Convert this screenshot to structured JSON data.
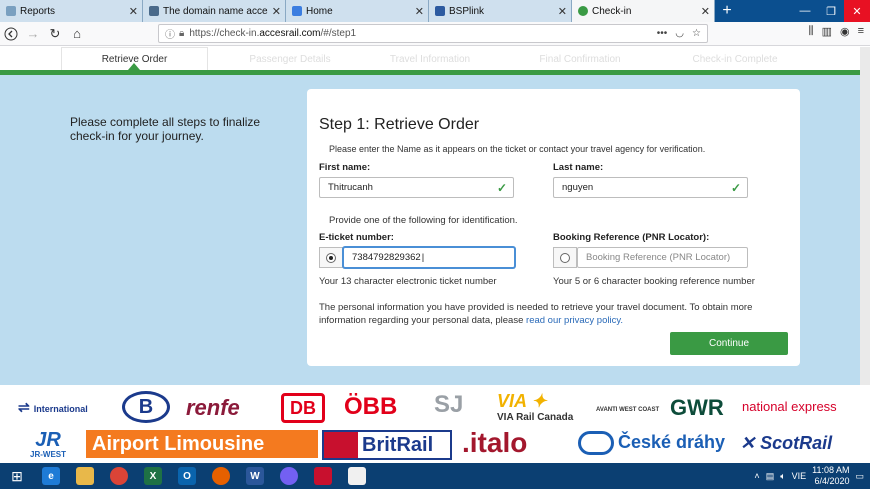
{
  "tabs": [
    {
      "label": "Reports",
      "icon": "document-icon",
      "color": "#cfe0ee"
    },
    {
      "label": "The domain name accessrail.c",
      "icon": "horseshoe-icon",
      "color": "#cfe0ee"
    },
    {
      "label": "Home",
      "icon": "star-icon",
      "color": "#cfe0ee"
    },
    {
      "label": "BSPlink",
      "icon": "plane-icon",
      "color": "#cfe0ee"
    },
    {
      "label": "Check-in",
      "icon": "checkin-icon",
      "color": "#f5f6f7"
    }
  ],
  "url": {
    "prefix": "https://check-in.",
    "host": "accesrail.com",
    "path": "/#/step1"
  },
  "steps": [
    "Retrieve Order",
    "Passenger Details",
    "Travel Information",
    "Final Confirmation",
    "Check-in Complete"
  ],
  "intro": "Please complete all steps to finalize check-in for your journey.",
  "form": {
    "title": "Step 1: Retrieve Order",
    "subtitle": "Please enter the Name as it appears on the ticket or contact your travel agency for verification.",
    "first_name_label": "First name:",
    "first_name_value": "Thitrucanh",
    "last_name_label": "Last name:",
    "last_name_value": "nguyen",
    "provide_text": "Provide one of the following for identification.",
    "eticket_label": "E-ticket number:",
    "eticket_value": "7384792829362",
    "eticket_hint": "Your 13 character electronic ticket number",
    "pnr_label": "Booking Reference (PNR Locator):",
    "pnr_placeholder": "Booking Reference (PNR Locator)",
    "pnr_hint": "Your 5 or 6 character booking reference number",
    "privacy_text": "The personal information you have provided is needed to retrieve your travel document. To obtain more information regarding your personal data, please",
    "privacy_link": "read our privacy policy.",
    "continue_label": "Continue",
    "check_mark": "✓"
  },
  "partners": [
    {
      "name": "International",
      "color": "#1b3a8c"
    },
    {
      "name": "B",
      "color": "#1b3a8c"
    },
    {
      "name": "renfe",
      "color": "#8b1a3a"
    },
    {
      "name": "DB",
      "color": "#e2001a"
    },
    {
      "name": "ÖBB",
      "color": "#e2001a"
    },
    {
      "name": "SJ",
      "color": "#9aa0a6"
    },
    {
      "name": "VIA Rail Canada",
      "color": "#f2b200"
    },
    {
      "name": "AVANTI WEST COAST",
      "color": "#333333"
    },
    {
      "name": "GWR",
      "color": "#0d4c3a"
    },
    {
      "name": "national express",
      "color": "#d6002a"
    },
    {
      "name": "JR-WEST",
      "color": "#1b5fb5"
    },
    {
      "name": "Airport Limousine",
      "color": "#f47a1f"
    },
    {
      "name": "BritRail",
      "color": "#1b3a8c"
    },
    {
      "name": ".italo",
      "color": "#a3172d"
    },
    {
      "name": "České dráhy",
      "color": "#1b5fb5"
    },
    {
      "name": "ScotRail",
      "color": "#1b3a8c"
    }
  ],
  "taskbar": {
    "time": "11:08 AM",
    "date": "6/4/2020",
    "lang": "VIE"
  }
}
